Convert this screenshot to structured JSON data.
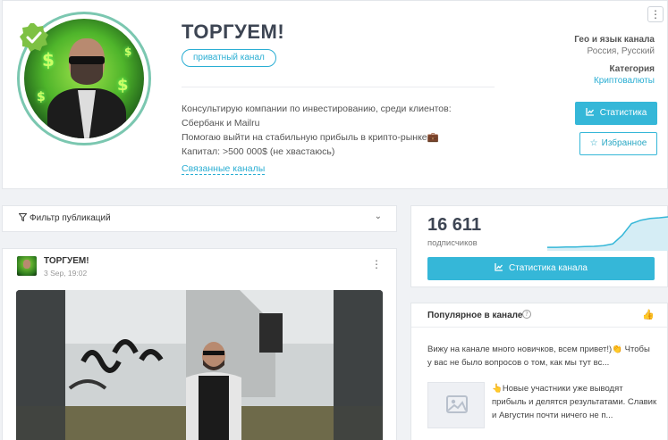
{
  "channel": {
    "title": "ТОРГУЕМ!",
    "badge": "приватный канал",
    "description": [
      "Консультирую компании по инвестированию, среди клиентов: Сбербанк и Mailru",
      "Помогаю выйти на стабильную прибыль в крипто-рынке💼",
      "Капитал: >500 000$ (не хвастаюсь)"
    ],
    "related_link": "Связанные каналы",
    "menu_icon": "⋮"
  },
  "meta": {
    "geo_label": "Гео и язык канала",
    "geo_value": "Россия, Русский",
    "category_label": "Категория",
    "category_value": "Криптовалюты"
  },
  "buttons": {
    "stats": "Статистика",
    "favorite": "Избранное",
    "channel_stats": "Статистика канала"
  },
  "filter": {
    "label": "Фильтр публикаций"
  },
  "post": {
    "author": "ТОРГУЕМ!",
    "date": "3 Sep, 19:02"
  },
  "stats": {
    "subscribers": "16 611",
    "subscribers_label": "подписчиков",
    "trend": [
      0.05,
      0.05,
      0.06,
      0.06,
      0.07,
      0.08,
      0.1,
      0.15,
      0.4,
      0.75,
      0.85,
      0.9,
      0.92,
      0.95
    ]
  },
  "popular": {
    "title": "Популярное в канале",
    "post1": "Вижу на канале много новичков, всем привет!)👏 Чтобы у вас не было вопросов о том, как мы тут вс...",
    "post2": "👆Новые участники уже выводят прибыль и делятся результатами. Славик и Августин почти ничего не п..."
  },
  "colors": {
    "accent": "#35b7d8",
    "title": "#3d4553",
    "verified": "#7ec144"
  }
}
